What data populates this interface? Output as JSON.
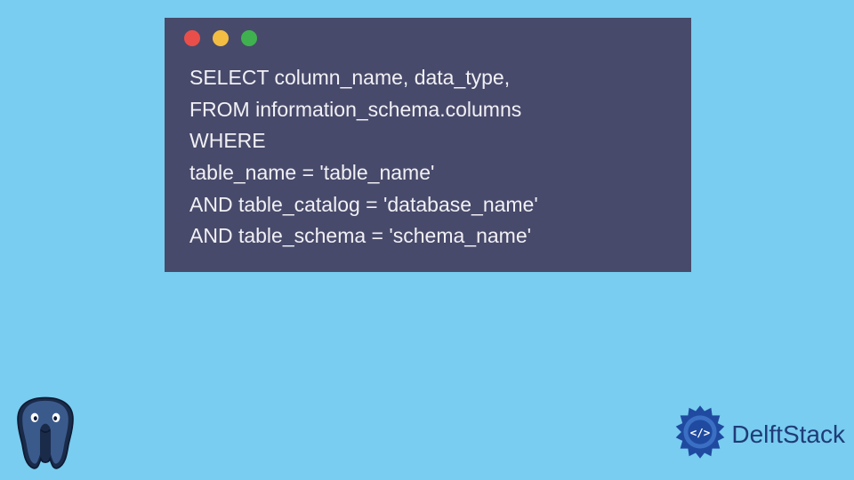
{
  "colors": {
    "background": "#79cdf0",
    "window_bg": "#484a6b",
    "code_text": "#f1f0f5",
    "dot_red": "#e94f4a",
    "dot_yellow": "#f2bd42",
    "dot_green": "#3fb24f",
    "brand_text": "#1f3c78"
  },
  "window": {
    "controls": [
      "close",
      "minimize",
      "maximize"
    ]
  },
  "code_lines": [
    "SELECT column_name, data_type,",
    "FROM information_schema.columns",
    "WHERE",
    "table_name = 'table_name'",
    "AND table_catalog = 'database_name'",
    "AND table_schema = 'schema_name'"
  ],
  "logos": {
    "bottom_left": "postgresql-elephant",
    "bottom_right_icon": "delftstack-gear",
    "bottom_right_text": "DelftStack"
  }
}
